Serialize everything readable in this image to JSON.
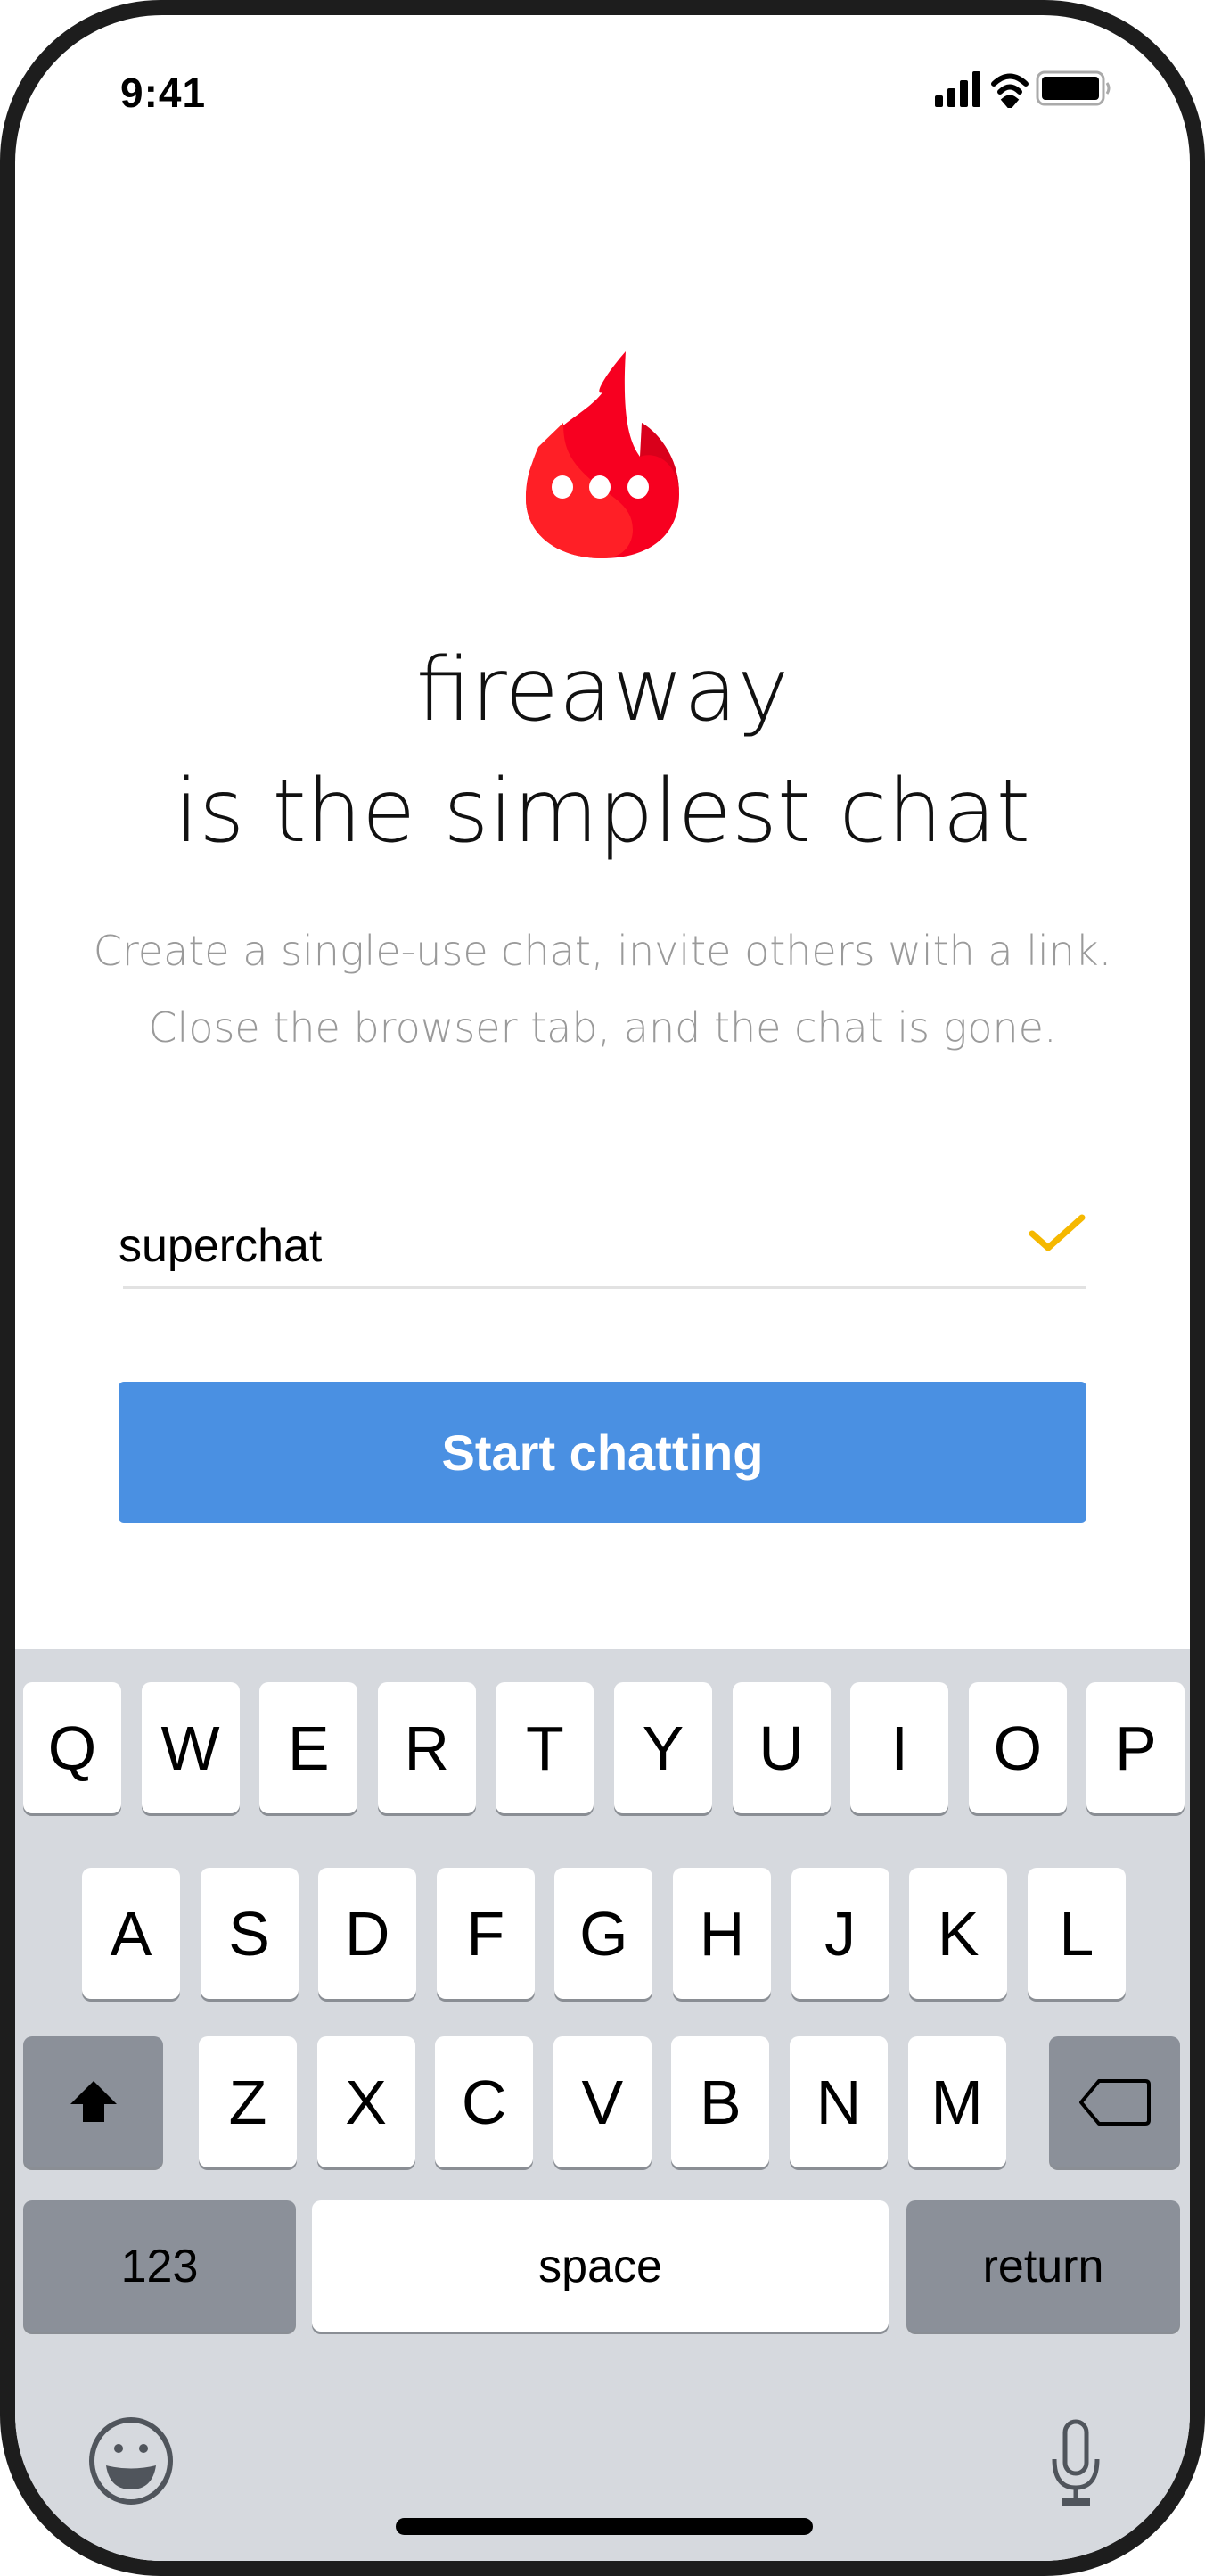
{
  "status_bar": {
    "time": "9:41",
    "icons": [
      "cellular-signal-icon",
      "wifi-icon",
      "battery-icon"
    ]
  },
  "logo": {
    "icon": "flame-chat-bubble-icon",
    "colors": [
      "#ff1f26",
      "#f70020",
      "#d9001b"
    ]
  },
  "hero": {
    "title_line1": "fireaway",
    "title_line2": "is the simplest chat",
    "subtitle_line1": "Create a single-use chat, invite others with a link.",
    "subtitle_line2": "Close the browser tab, and the chat is gone."
  },
  "form": {
    "chat_name_value": "superchat",
    "valid_icon": "checkmark-icon",
    "check_color": "#f5b800",
    "start_button_label": "Start chatting",
    "button_color": "#4a90e2"
  },
  "keyboard": {
    "row1": [
      "Q",
      "W",
      "E",
      "R",
      "T",
      "Y",
      "U",
      "I",
      "O",
      "P"
    ],
    "row2": [
      "A",
      "S",
      "D",
      "F",
      "G",
      "H",
      "J",
      "K",
      "L"
    ],
    "row3": [
      "Z",
      "X",
      "C",
      "V",
      "B",
      "N",
      "M"
    ],
    "numbers_label": "123",
    "space_label": "space",
    "return_label": "return",
    "shift_icon": "shift-icon",
    "delete_icon": "backspace-icon",
    "emoji_icon": "emoji-icon",
    "mic_icon": "microphone-icon"
  }
}
